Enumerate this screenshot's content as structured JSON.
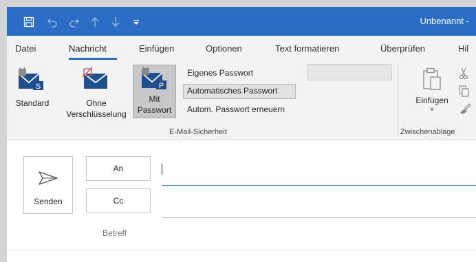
{
  "window": {
    "title": "Unbenannt -"
  },
  "quick_access": {
    "icons": [
      "save-icon",
      "undo-icon",
      "redo-icon",
      "arrow-up-icon",
      "arrow-down-icon",
      "customize-qat-icon"
    ]
  },
  "tabs": [
    {
      "label": "Datei"
    },
    {
      "label": "Nachricht",
      "active": true
    },
    {
      "label": "Einfügen"
    },
    {
      "label": "Optionen"
    },
    {
      "label": "Text formatieren"
    },
    {
      "label": "Überprüfen"
    },
    {
      "label": "Hil"
    }
  ],
  "ribbon": {
    "security_group": {
      "buttons": [
        {
          "label_lines": [
            "Standard"
          ],
          "icon": "signed-envelope-lock-icon"
        },
        {
          "label_lines": [
            "Ohne",
            "Verschlüsselung"
          ],
          "icon": "unencrypted-envelope-icon"
        },
        {
          "label_lines": [
            "Mit",
            "Passwort"
          ],
          "icon": "password-envelope-icon",
          "selected": true
        }
      ],
      "options": [
        {
          "label": "Eigenes Passwort"
        },
        {
          "label": "Automatisches Passwort",
          "selected": true
        },
        {
          "label": "Autom. Passwort erneuern"
        }
      ],
      "group_label": "E-Mail-Sicherheit"
    },
    "clipboard_group": {
      "paste_label": "Einfügen",
      "paste_dropdown": "˅",
      "group_label": "Zwischenablage"
    },
    "colors": {
      "accent": "#2b6cc4",
      "envelope": "#1f4e8c",
      "disabled_red": "#c0504d"
    }
  },
  "compose": {
    "send_label": "Senden",
    "to_label": "An",
    "cc_label": "Cc",
    "subject_label": "Betreff",
    "to_value": "",
    "cc_value": "",
    "subject_value": ""
  }
}
